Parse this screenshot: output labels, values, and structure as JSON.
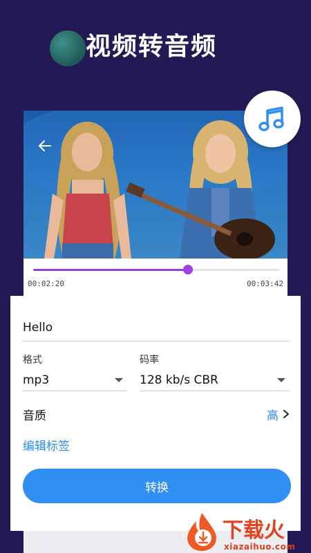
{
  "header": {
    "title": "视频转音频"
  },
  "player": {
    "current_time": "00:02:20",
    "total_time": "00:03:42",
    "progress": 0.63
  },
  "form": {
    "file_name": "Hello",
    "format_label": "格式",
    "format_value": "mp3",
    "bitrate_label": "码率",
    "bitrate_value": "128 kb/s CBR",
    "quality_label": "音质",
    "quality_value": "高",
    "edit_tags_label": "编辑标签",
    "convert_button": "转换"
  },
  "watermark": {
    "brand": "下载火",
    "site": "xiazaihuo.com"
  },
  "colors": {
    "background": "#231a55",
    "accent": "#2f8ff2",
    "progress": "#9b3fd6"
  },
  "icons": {
    "back": "back-arrow-icon",
    "music": "music-note-icon",
    "quality": "chevron-right-icon"
  }
}
